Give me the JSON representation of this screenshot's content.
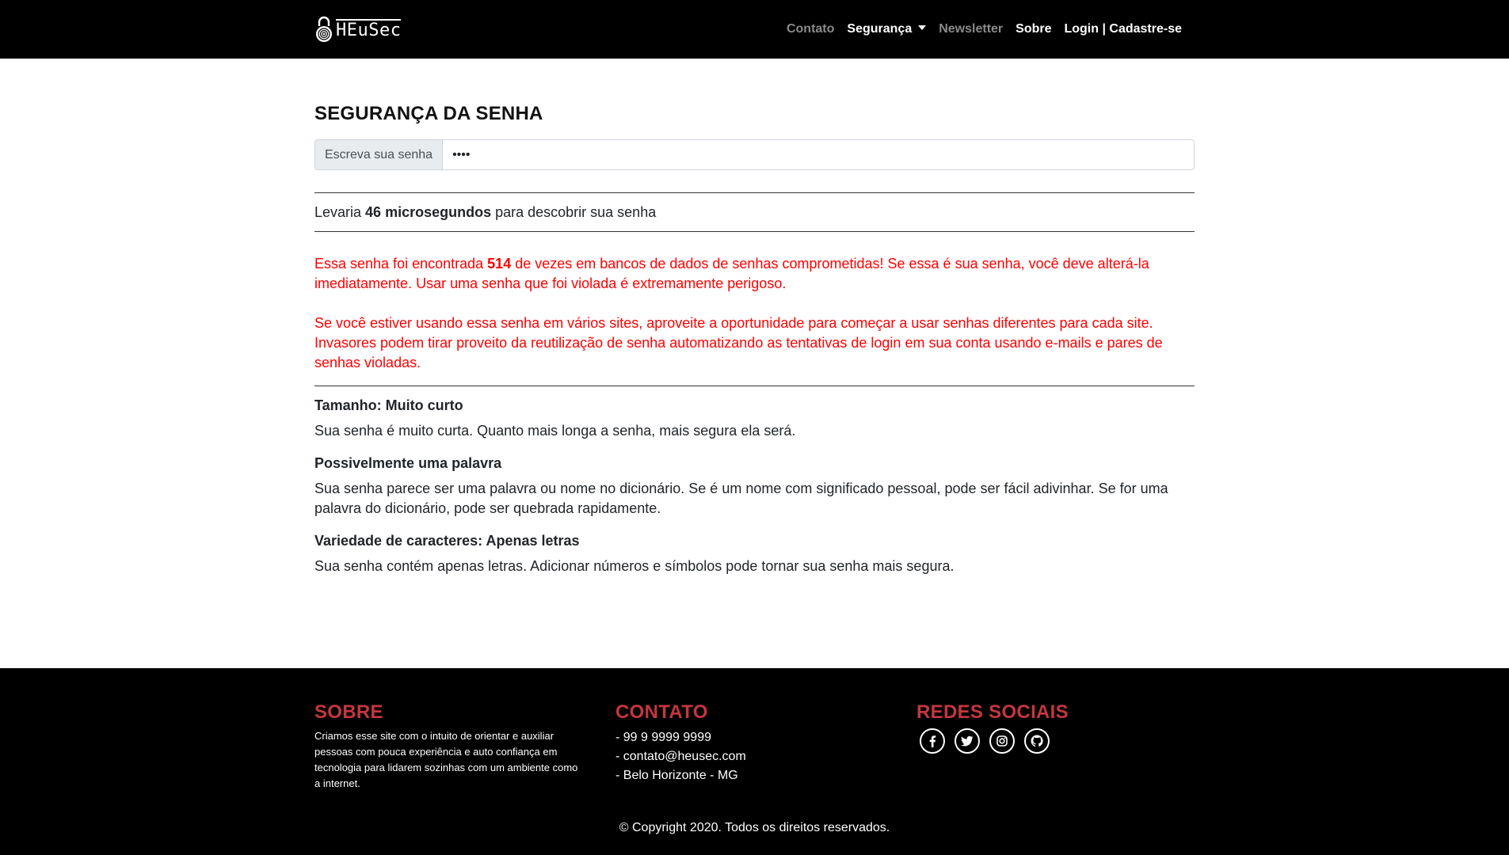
{
  "navbar": {
    "logo_text": "HEuSec",
    "links": {
      "contato": "Contato",
      "seguranca": "Segurança",
      "newsletter": "Newsletter",
      "sobre": "Sobre",
      "login": "Login | Cadastre-se"
    }
  },
  "main": {
    "title": "SEGURANÇA DA SENHA",
    "password_input": {
      "label": "Escreva sua senha",
      "value": "••••"
    },
    "crack_time": {
      "prefix": "Levaria",
      "value": "46 microsegundos",
      "suffix": "para descobrir sua senha"
    },
    "breach_warning": {
      "p1_before": "Essa senha foi encontrada",
      "p1_count": "514",
      "p1_after": "de vezes em bancos de dados de senhas comprometidas! Se essa é sua senha, você deve alterá-la imediatamente. Usar uma senha que foi violada é extremamente perigoso.",
      "p2": "Se você estiver usando essa senha em vários sites, aproveite a oportunidade para começar a usar senhas diferentes para cada site. Invasores podem tirar proveito da reutilização de senha automatizando as tentativas de login em sua conta usando e-mails e pares de senhas violadas."
    },
    "feedback": [
      {
        "title": "Tamanho: Muito curto",
        "text": "Sua senha é muito curta. Quanto mais longa a senha, mais segura ela será."
      },
      {
        "title": "Possivelmente uma palavra",
        "text": "Sua senha parece ser uma palavra ou nome no dicionário. Se é um nome com significado pessoal, pode ser fácil adivinhar. Se for uma palavra do dicionário, pode ser quebrada rapidamente."
      },
      {
        "title": "Variedade de caracteres: Apenas letras",
        "text": "Sua senha contém apenas letras. Adicionar números e símbolos pode tornar sua senha mais segura."
      }
    ]
  },
  "footer": {
    "about": {
      "heading": "SOBRE",
      "text": "Criamos esse site com o intuito de orientar e auxiliar pessoas com pouca experiência e auto confiança em tecnologia para lidarem sozinhas com um ambiente como a internet."
    },
    "contact": {
      "heading": "CONTATO",
      "phone": "- 99 9 9999 9999",
      "email": "- contato@heusec.com",
      "location": "- Belo Horizonte - MG"
    },
    "social": {
      "heading": "REDES SOCIAIS",
      "icons": [
        "facebook-icon",
        "twitter-icon",
        "instagram-icon",
        "github-icon"
      ]
    },
    "copyright": "© Copyright 2020. Todos os direitos reservados."
  },
  "colors": {
    "navbar_bg": "#000000",
    "warning_red": "#ff0000",
    "footer_heading": "#c5363f"
  }
}
